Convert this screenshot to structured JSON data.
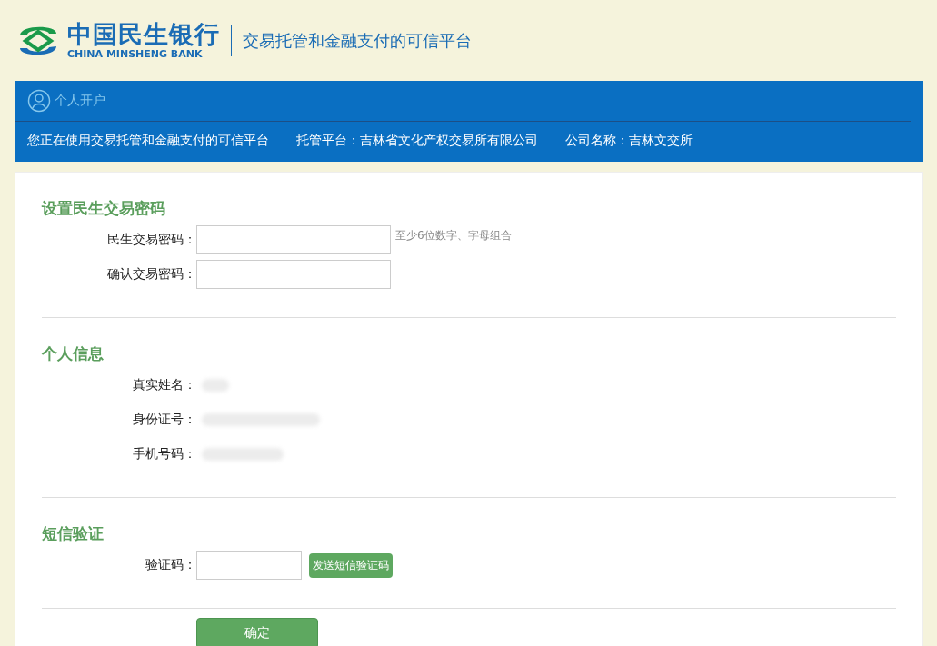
{
  "header": {
    "bank_name": "中国民生银行",
    "bank_name_en": "CHINA MINSHENG BANK",
    "slogan": "交易托管和金融支付的可信平台"
  },
  "banner": {
    "title": "个人开户",
    "info": [
      "您正在使用交易托管和金融支付的可信平台",
      "托管平台：吉林省文化产权交易所有限公司",
      "公司名称：吉林文交所"
    ]
  },
  "sections": [
    {
      "title": "设置民生交易密码",
      "rows": [
        {
          "kind": "input",
          "label": "民生交易密码：",
          "hint": "至少6位数字、字母组合"
        },
        {
          "kind": "input",
          "label": "确认交易密码："
        }
      ]
    },
    {
      "title": "个人信息",
      "rows": [
        {
          "kind": "redacted",
          "label": "真实姓名："
        },
        {
          "kind": "redacted",
          "label": "身份证号："
        },
        {
          "kind": "redacted",
          "label": "手机号码："
        }
      ]
    },
    {
      "title": "短信验证",
      "rows": [
        {
          "kind": "code",
          "label": "验证码：",
          "button": "发送短信验证码"
        }
      ]
    }
  ],
  "submit": "确定"
}
